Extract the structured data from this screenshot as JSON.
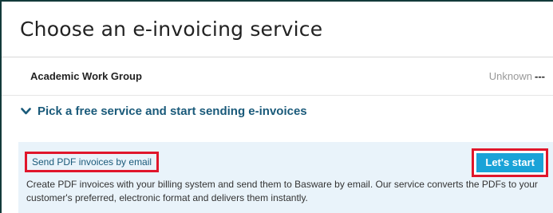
{
  "header": {
    "title": "Choose an e-invoicing service"
  },
  "organization": {
    "name": "Academic Work Group",
    "status": "Unknown",
    "status_suffix": "---"
  },
  "section": {
    "title": "Pick a free service and start sending e-invoices",
    "expanded": true,
    "icon": "chevron-down-icon"
  },
  "service": {
    "link_label": "Send PDF invoices by email",
    "start_label": "Let's start",
    "description": "Create PDF invoices with your billing system and send them to Basware by email. Our service converts the PDFs to your customer's preferred, electronic format and delivers them instantly."
  },
  "colors": {
    "accent": "#1aa3d8",
    "link": "#1a5a7a",
    "highlight": "#e0162b",
    "panel_bg": "#e9f3fa"
  }
}
